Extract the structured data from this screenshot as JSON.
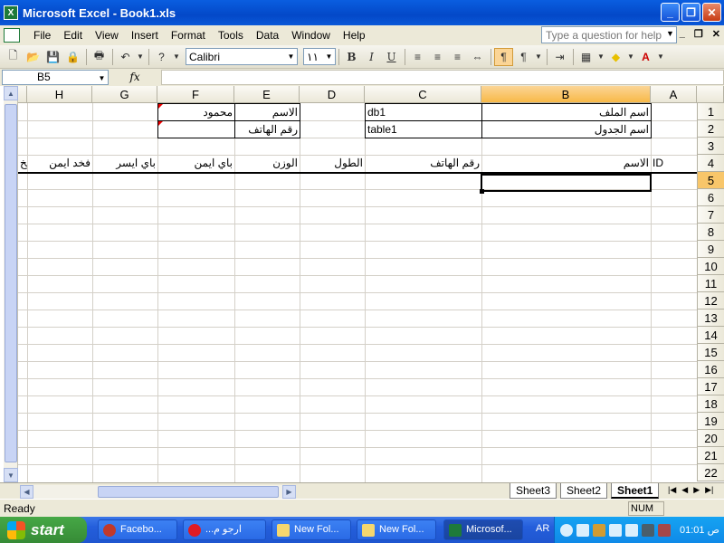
{
  "window": {
    "title": "Microsoft Excel - Book1.xls",
    "app_icon": "excel-icon"
  },
  "menu": [
    "File",
    "Edit",
    "View",
    "Insert",
    "Format",
    "Tools",
    "Data",
    "Window",
    "Help"
  ],
  "help_box": {
    "placeholder": "Type a question for help"
  },
  "toolbar": {
    "font": "Calibri",
    "size": "١١"
  },
  "formula": {
    "namebox": "B5",
    "fx": "fx",
    "value": ""
  },
  "columns": [
    "H",
    "G",
    "F",
    "E",
    "D",
    "C",
    "B",
    "A"
  ],
  "rows": [
    "1",
    "2",
    "3",
    "4",
    "5",
    "6",
    "7",
    "8",
    "9",
    "10",
    "11",
    "12",
    "13",
    "14",
    "15",
    "16",
    "17",
    "18",
    "19",
    "20",
    "21",
    "22"
  ],
  "cells": {
    "B1": "اسم الملف",
    "C1": "db1",
    "E1": "الاسم",
    "F1": "محمود",
    "B2": "اسم الجدول",
    "C2": "table1",
    "E2": "رقم الهاتف",
    "A4": "ID",
    "B4": "الاسم",
    "C4": "رقم الهاتف",
    "D4": "الطول",
    "E4": "الوزن",
    "F4": "باي ايمن",
    "G4": "باي ايسر",
    "H4": "فخد ايمن",
    "I4": "فخ"
  },
  "sheets": [
    "Sheet3",
    "Sheet2",
    "Sheet1"
  ],
  "active_sheet": "Sheet1",
  "status": {
    "text": "Ready",
    "num": "NUM"
  },
  "taskbar": {
    "start": "start",
    "buttons": [
      "Facebo...",
      "...ارجو م",
      "New Fol...",
      "New Fol...",
      "Microsof..."
    ],
    "lang": "AR",
    "clock": "01:01 ص"
  },
  "colors": {
    "selected_header": "#f8b948",
    "titlebar": "#0348c8",
    "taskbar": "#245edb"
  }
}
